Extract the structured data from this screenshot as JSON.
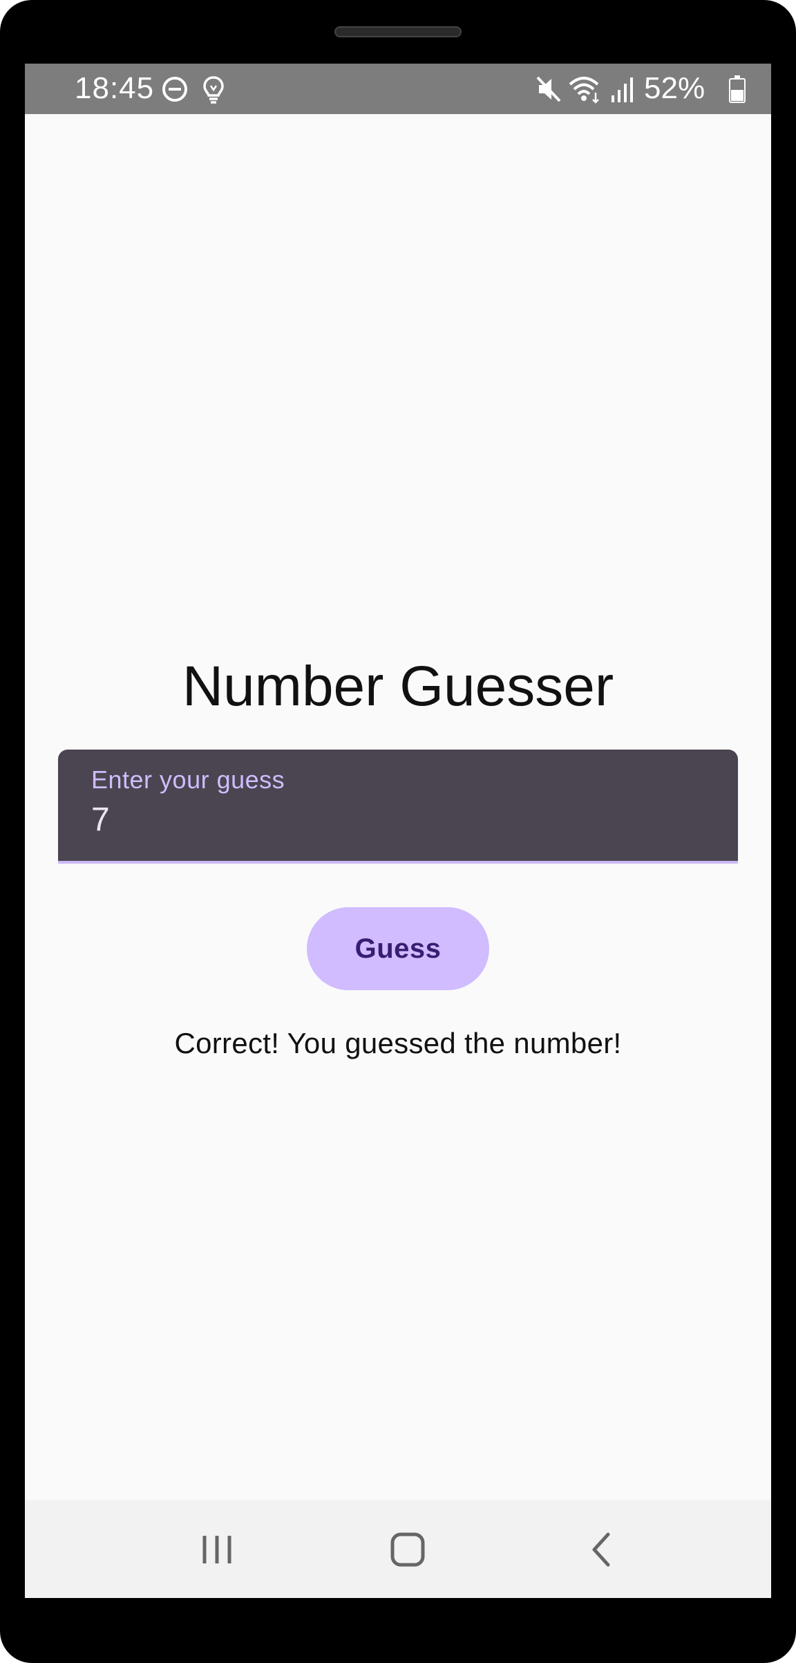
{
  "status_bar": {
    "time": "18:45",
    "battery": "52%",
    "icons": [
      "do-not-disturb-icon",
      "bulb-icon",
      "mute-icon",
      "wifi-icon",
      "signal-icon",
      "battery-icon"
    ]
  },
  "app": {
    "title": "Number Guesser",
    "input": {
      "label": "Enter your guess",
      "value": "7"
    },
    "guess_button_label": "Guess",
    "result_message": "Correct! You guessed the number!"
  },
  "nav_bar": {
    "icons": [
      "recent-apps-icon",
      "home-icon",
      "back-icon"
    ]
  },
  "colors": {
    "field_background": "#4a4550",
    "accent": "#d0bcff",
    "button_text": "#381e72",
    "status_bar": "#7d7d7d"
  }
}
